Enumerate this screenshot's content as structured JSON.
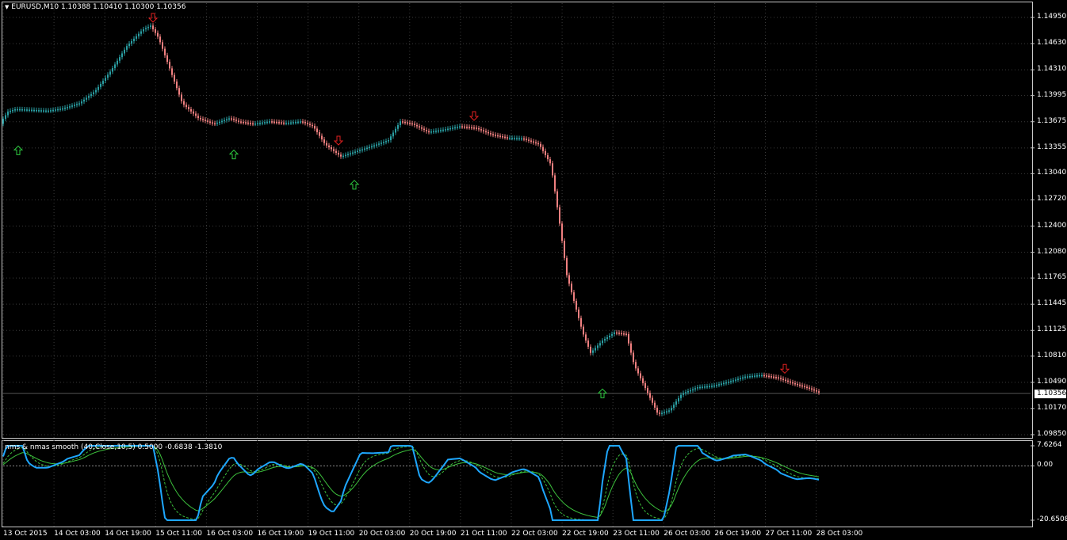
{
  "header": {
    "symbol_line": "EURUSD,M10  1.10388 1.10410 1.10300 1.10356",
    "indicator_title": "nms & nmas smooth (40,Close,10,5) 0.5000 -0.6838 -1.3810"
  },
  "price_axis": [
    "1.14950",
    "1.14630",
    "1.14310",
    "1.13995",
    "1.13675",
    "1.13355",
    "1.13040",
    "1.12720",
    "1.12400",
    "1.12080",
    "1.11765",
    "1.11445",
    "1.11125",
    "1.10810",
    "1.10490",
    "1.10170",
    "1.09850"
  ],
  "current_price": "1.10356",
  "indicator_axis": [
    "7.6264",
    "0.00",
    "-20.6508"
  ],
  "time_axis": [
    "13 Oct 2015",
    "14 Oct 03:00",
    "14 Oct 19:00",
    "15 Oct 11:00",
    "16 Oct 03:00",
    "16 Oct 19:00",
    "19 Oct 11:00",
    "20 Oct 03:00",
    "20 Oct 19:00",
    "21 Oct 11:00",
    "22 Oct 03:00",
    "22 Oct 19:00",
    "23 Oct 11:00",
    "26 Oct 03:00",
    "26 Oct 19:00",
    "27 Oct 11:00",
    "28 Oct 03:00"
  ],
  "colors": {
    "up_bar": "#2a9fa3",
    "down_bar": "#f08080",
    "up_arrow": "#2ecc40",
    "down_arrow": "#e02020",
    "nms_line": "#1ea7ff",
    "nmas_line": "#3cbf3c",
    "grid": "#3a3a3a",
    "frame": "#c8c8c8"
  },
  "chart_data": {
    "type": "line",
    "title": "EURUSD,M10",
    "price_range": [
      1.0985,
      1.1495
    ],
    "close_path": [
      [
        0,
        1.1365
      ],
      [
        10,
        1.138
      ],
      [
        20,
        1.1383
      ],
      [
        40,
        1.1382
      ],
      [
        60,
        1.1381
      ],
      [
        80,
        1.1384
      ],
      [
        100,
        1.139
      ],
      [
        120,
        1.1405
      ],
      [
        140,
        1.143
      ],
      [
        160,
        1.146
      ],
      [
        180,
        1.148
      ],
      [
        190,
        1.1485
      ],
      [
        200,
        1.147
      ],
      [
        215,
        1.143
      ],
      [
        230,
        1.139
      ],
      [
        250,
        1.1372
      ],
      [
        270,
        1.1365
      ],
      [
        290,
        1.1372
      ],
      [
        300,
        1.1368
      ],
      [
        320,
        1.1365
      ],
      [
        340,
        1.1368
      ],
      [
        360,
        1.1366
      ],
      [
        380,
        1.1368
      ],
      [
        395,
        1.1362
      ],
      [
        410,
        1.134
      ],
      [
        430,
        1.1325
      ],
      [
        445,
        1.133
      ],
      [
        470,
        1.1338
      ],
      [
        490,
        1.1345
      ],
      [
        505,
        1.1368
      ],
      [
        520,
        1.1365
      ],
      [
        540,
        1.1355
      ],
      [
        560,
        1.1358
      ],
      [
        580,
        1.1362
      ],
      [
        600,
        1.136
      ],
      [
        620,
        1.1352
      ],
      [
        640,
        1.1348
      ],
      [
        660,
        1.1347
      ],
      [
        680,
        1.134
      ],
      [
        695,
        1.1315
      ],
      [
        705,
        1.125
      ],
      [
        715,
        1.118
      ],
      [
        725,
        1.1145
      ],
      [
        735,
        1.111
      ],
      [
        745,
        1.1085
      ],
      [
        760,
        1.11
      ],
      [
        775,
        1.111
      ],
      [
        790,
        1.1108
      ],
      [
        800,
        1.107
      ],
      [
        815,
        1.104
      ],
      [
        830,
        1.101
      ],
      [
        845,
        1.1015
      ],
      [
        860,
        1.1035
      ],
      [
        880,
        1.1043
      ],
      [
        900,
        1.1045
      ],
      [
        920,
        1.105
      ],
      [
        940,
        1.1056
      ],
      [
        960,
        1.1058
      ],
      [
        980,
        1.1055
      ],
      [
        1000,
        1.1048
      ],
      [
        1020,
        1.1042
      ],
      [
        1035,
        1.1036
      ]
    ],
    "up_arrows": [
      [
        23,
        1.1332
      ],
      [
        295,
        1.1327
      ],
      [
        447,
        1.129
      ],
      [
        760,
        1.1035
      ]
    ],
    "down_arrows": [
      [
        193,
        1.1495
      ],
      [
        427,
        1.1345
      ],
      [
        598,
        1.1375
      ],
      [
        990,
        1.1066
      ]
    ],
    "indicator_range": [
      -20.6508,
      7.6264
    ]
  }
}
